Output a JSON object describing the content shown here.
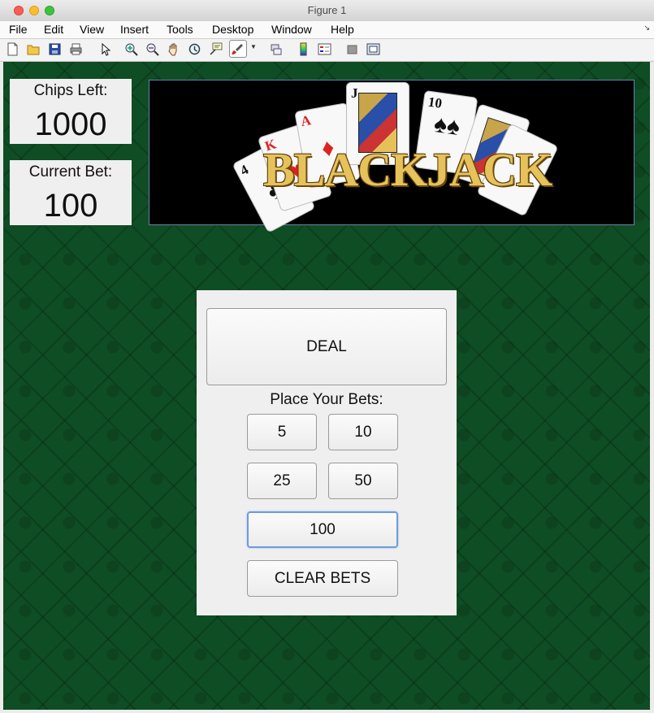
{
  "window": {
    "title": "Figure 1"
  },
  "menubar": {
    "items": [
      "File",
      "Edit",
      "View",
      "Insert",
      "Tools",
      "Desktop",
      "Window",
      "Help"
    ]
  },
  "toolbar": {
    "icons": [
      "new-file-icon",
      "open-folder-icon",
      "save-icon",
      "print-icon",
      "pointer-icon",
      "zoom-in-icon",
      "zoom-out-icon",
      "pan-hand-icon",
      "rotate-3d-icon",
      "data-cursor-icon",
      "brush-icon",
      "link-plot-icon",
      "colorbar-icon",
      "legend-icon",
      "hide-plot-tools-icon",
      "show-plot-tools-icon"
    ]
  },
  "chips": {
    "label": "Chips Left:",
    "value": "1000"
  },
  "current_bet": {
    "label": "Current Bet:",
    "value": "100"
  },
  "banner": {
    "title": "BLACKJACK",
    "card_ranks": [
      "4",
      "K",
      "A",
      "J",
      "10"
    ]
  },
  "controls": {
    "deal_label": "DEAL",
    "place_bets_label": "Place Your Bets:",
    "bet_5": "5",
    "bet_10": "10",
    "bet_25": "25",
    "bet_50": "50",
    "bet_100": "100",
    "clear_label": "CLEAR BETS"
  },
  "colors": {
    "felt": "#0f4d24",
    "panel": "#efefef",
    "bet_focus": "#6f9bd9",
    "banner_gold": "#e6c25b"
  }
}
